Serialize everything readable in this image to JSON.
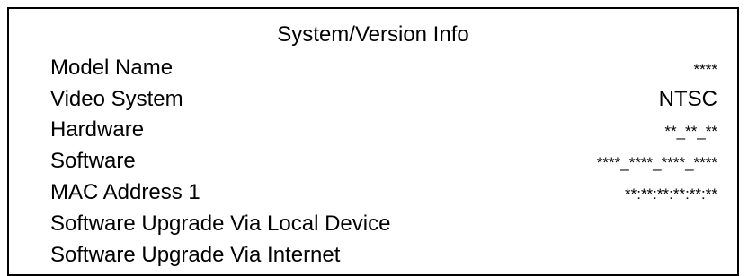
{
  "panel": {
    "title": "System/Version Info"
  },
  "rows": [
    {
      "label": "Model Name",
      "value": "****"
    },
    {
      "label": "Video System",
      "value": "NTSC"
    },
    {
      "label": "Hardware",
      "value": "**_**_**"
    },
    {
      "label": "Software",
      "value": "****_****_****_****"
    },
    {
      "label": "MAC Address 1",
      "value": "**:**:**:**:**:**"
    }
  ],
  "actions": [
    {
      "label": "Software Upgrade Via Local Device"
    },
    {
      "label": "Software Upgrade Via Internet"
    }
  ]
}
